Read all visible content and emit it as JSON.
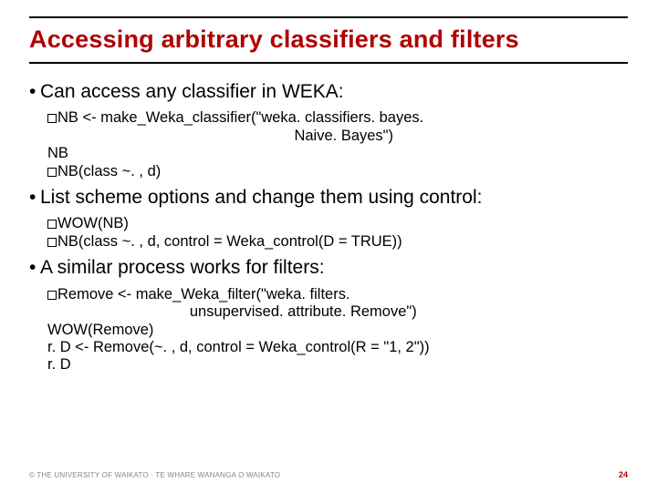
{
  "title": "Accessing arbitrary classifiers and filters",
  "bullets": {
    "b1": "Can access any classifier in WEKA:",
    "b2": "List scheme options and change them using control:",
    "b3": "A similar process works for filters:"
  },
  "code1": {
    "l1a": "N",
    "l1b": "B <- make_Weka_classifier(\"weka. classifiers. bayes.",
    "l2": "                                                           Naive. Bayes\")",
    "l3": "NB",
    "l4a": "N",
    "l4b": "B(class ~. , d)"
  },
  "code2": {
    "l1a": "W",
    "l1b": "OW(NB)",
    "l2a": "N",
    "l2b": "B(class ~. , d, control = Weka_control(D = TRUE))"
  },
  "code3": {
    "l1a": "R",
    "l1b": "emove <- make_Weka_filter(\"weka. filters.",
    "l2": "                                  unsupervised. attribute. Remove\")",
    "l3": "WOW(Remove)",
    "l4": "r. D <- Remove(~. , d, control = Weka_control(R = \"1, 2\"))",
    "l5": "r. D"
  },
  "footer": "© THE UNIVERSITY OF WAIKATO  ·  TE WHARE WANANGA O WAIKATO",
  "pagenum": "24"
}
